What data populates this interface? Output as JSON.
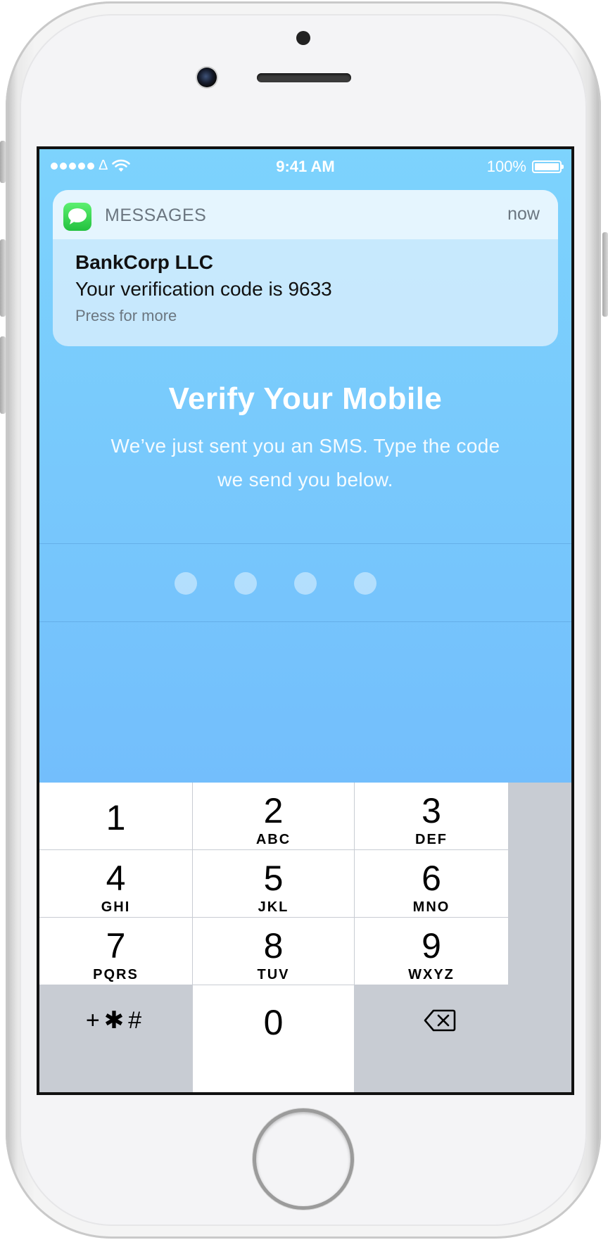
{
  "status_bar": {
    "carrier": "Δ",
    "time": "9:41 AM",
    "battery": "100%",
    "signal_icon": "signal-dots-icon",
    "wifi_icon": "wifi-icon",
    "battery_icon": "battery-full-icon"
  },
  "notification": {
    "app_name": "MESSAGES",
    "time": "now",
    "title": "BankCorp LLC",
    "message": "Your verification code is 9633",
    "more": "Press for more",
    "icon": "messages-app-icon"
  },
  "main": {
    "title": "Verify Your Mobile",
    "subtitle": "We’ve just sent you an SMS. Type the code we send you below.",
    "code_length": 4,
    "code_entered": 0
  },
  "keypad": {
    "keys": [
      {
        "digit": "1",
        "letters": ""
      },
      {
        "digit": "2",
        "letters": "ABC"
      },
      {
        "digit": "3",
        "letters": "DEF"
      },
      {
        "digit": "4",
        "letters": "GHI"
      },
      {
        "digit": "5",
        "letters": "JKL"
      },
      {
        "digit": "6",
        "letters": "MNO"
      },
      {
        "digit": "7",
        "letters": "PQRS"
      },
      {
        "digit": "8",
        "letters": "TUV"
      },
      {
        "digit": "9",
        "letters": "WXYZ"
      }
    ],
    "symbols": "+✱#",
    "zero": "0",
    "backspace_icon": "backspace-icon"
  },
  "colors": {
    "gradient_top": "#7dd3fd",
    "gradient_bottom": "#6eb4fb",
    "keypad_dark": "#c8ccd3"
  }
}
